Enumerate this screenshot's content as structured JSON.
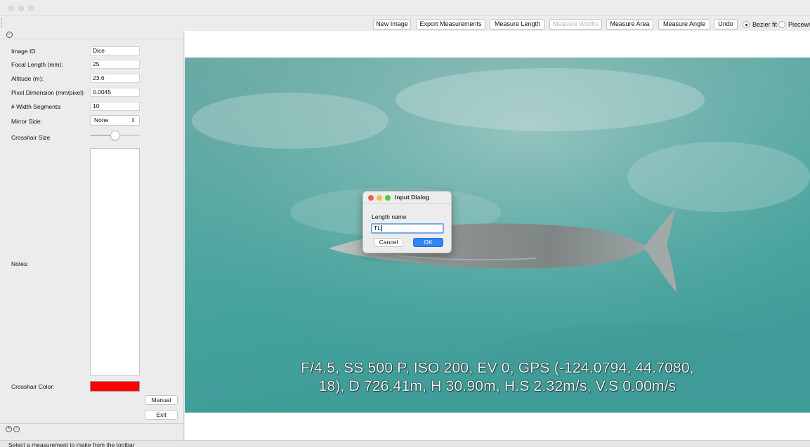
{
  "toolbar": {
    "buttons": [
      {
        "label": "New Image"
      },
      {
        "label": "Export Measurements"
      },
      {
        "label": "Measure Length"
      },
      {
        "label": "Measure Widths"
      },
      {
        "label": "Measure Area"
      },
      {
        "label": "Measure Angle"
      },
      {
        "label": "Undo"
      }
    ],
    "radios": [
      {
        "label": "Bezier fit",
        "selected": true
      },
      {
        "label": "Piecewis",
        "selected": false
      }
    ]
  },
  "panel": {
    "fields": [
      {
        "label": "Image ID",
        "value": "Dice"
      },
      {
        "label": "Focal Length (mm):",
        "value": "25"
      },
      {
        "label": "Altitude (m):",
        "value": "23.6"
      },
      {
        "label": "Pixel Dimension (mm/pixel)",
        "value": "0.0045"
      },
      {
        "label": "# Width Segments:",
        "value": "10"
      }
    ],
    "mirror_side": {
      "label": "Mirror Side:",
      "value": "None"
    },
    "crosshair_size": {
      "label": "Crosshair Size",
      "level": 0.5
    },
    "notes": {
      "label": "Notes:",
      "value": ""
    },
    "crosshair_color": {
      "label": "Crosshair Color:",
      "color": "#ff0000"
    },
    "manual_label": "Manual",
    "exit_label": "Exit"
  },
  "image": {
    "overlay_line1": "F/4.5, SS 500 P, ISO 200, EV 0, GPS (-124.0794, 44.7080,",
    "overlay_line2": "18), D 726.41m, H 30.90m, H.S 2.32m/s, V.S 0.00m/s"
  },
  "dialog": {
    "title": "Input Dialog",
    "prompt": "Length name",
    "value": "TL",
    "cancel_label": "Cancel",
    "ok_label": "OK"
  },
  "status": {
    "text": "Select a measurement to make from the toolbar"
  },
  "colors": {
    "accent": "#2f86f0",
    "water": "#4fa6a1",
    "crosshair": "#ff0000"
  }
}
